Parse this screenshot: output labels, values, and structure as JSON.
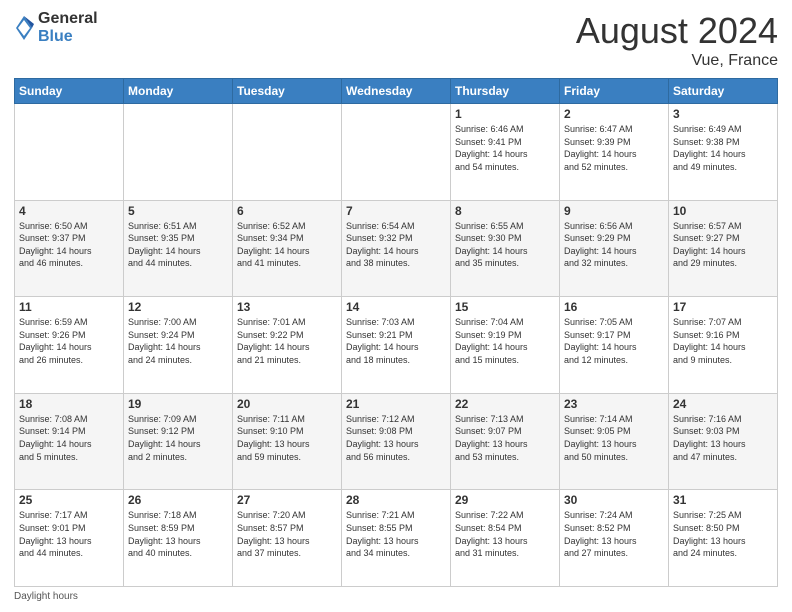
{
  "header": {
    "logo_line1": "General",
    "logo_line2": "Blue",
    "month_year": "August 2024",
    "location": "Vue, France"
  },
  "days_of_week": [
    "Sunday",
    "Monday",
    "Tuesday",
    "Wednesday",
    "Thursday",
    "Friday",
    "Saturday"
  ],
  "weeks": [
    [
      {
        "num": "",
        "info": ""
      },
      {
        "num": "",
        "info": ""
      },
      {
        "num": "",
        "info": ""
      },
      {
        "num": "",
        "info": ""
      },
      {
        "num": "1",
        "info": "Sunrise: 6:46 AM\nSunset: 9:41 PM\nDaylight: 14 hours\nand 54 minutes."
      },
      {
        "num": "2",
        "info": "Sunrise: 6:47 AM\nSunset: 9:39 PM\nDaylight: 14 hours\nand 52 minutes."
      },
      {
        "num": "3",
        "info": "Sunrise: 6:49 AM\nSunset: 9:38 PM\nDaylight: 14 hours\nand 49 minutes."
      }
    ],
    [
      {
        "num": "4",
        "info": "Sunrise: 6:50 AM\nSunset: 9:37 PM\nDaylight: 14 hours\nand 46 minutes."
      },
      {
        "num": "5",
        "info": "Sunrise: 6:51 AM\nSunset: 9:35 PM\nDaylight: 14 hours\nand 44 minutes."
      },
      {
        "num": "6",
        "info": "Sunrise: 6:52 AM\nSunset: 9:34 PM\nDaylight: 14 hours\nand 41 minutes."
      },
      {
        "num": "7",
        "info": "Sunrise: 6:54 AM\nSunset: 9:32 PM\nDaylight: 14 hours\nand 38 minutes."
      },
      {
        "num": "8",
        "info": "Sunrise: 6:55 AM\nSunset: 9:30 PM\nDaylight: 14 hours\nand 35 minutes."
      },
      {
        "num": "9",
        "info": "Sunrise: 6:56 AM\nSunset: 9:29 PM\nDaylight: 14 hours\nand 32 minutes."
      },
      {
        "num": "10",
        "info": "Sunrise: 6:57 AM\nSunset: 9:27 PM\nDaylight: 14 hours\nand 29 minutes."
      }
    ],
    [
      {
        "num": "11",
        "info": "Sunrise: 6:59 AM\nSunset: 9:26 PM\nDaylight: 14 hours\nand 26 minutes."
      },
      {
        "num": "12",
        "info": "Sunrise: 7:00 AM\nSunset: 9:24 PM\nDaylight: 14 hours\nand 24 minutes."
      },
      {
        "num": "13",
        "info": "Sunrise: 7:01 AM\nSunset: 9:22 PM\nDaylight: 14 hours\nand 21 minutes."
      },
      {
        "num": "14",
        "info": "Sunrise: 7:03 AM\nSunset: 9:21 PM\nDaylight: 14 hours\nand 18 minutes."
      },
      {
        "num": "15",
        "info": "Sunrise: 7:04 AM\nSunset: 9:19 PM\nDaylight: 14 hours\nand 15 minutes."
      },
      {
        "num": "16",
        "info": "Sunrise: 7:05 AM\nSunset: 9:17 PM\nDaylight: 14 hours\nand 12 minutes."
      },
      {
        "num": "17",
        "info": "Sunrise: 7:07 AM\nSunset: 9:16 PM\nDaylight: 14 hours\nand 9 minutes."
      }
    ],
    [
      {
        "num": "18",
        "info": "Sunrise: 7:08 AM\nSunset: 9:14 PM\nDaylight: 14 hours\nand 5 minutes."
      },
      {
        "num": "19",
        "info": "Sunrise: 7:09 AM\nSunset: 9:12 PM\nDaylight: 14 hours\nand 2 minutes."
      },
      {
        "num": "20",
        "info": "Sunrise: 7:11 AM\nSunset: 9:10 PM\nDaylight: 13 hours\nand 59 minutes."
      },
      {
        "num": "21",
        "info": "Sunrise: 7:12 AM\nSunset: 9:08 PM\nDaylight: 13 hours\nand 56 minutes."
      },
      {
        "num": "22",
        "info": "Sunrise: 7:13 AM\nSunset: 9:07 PM\nDaylight: 13 hours\nand 53 minutes."
      },
      {
        "num": "23",
        "info": "Sunrise: 7:14 AM\nSunset: 9:05 PM\nDaylight: 13 hours\nand 50 minutes."
      },
      {
        "num": "24",
        "info": "Sunrise: 7:16 AM\nSunset: 9:03 PM\nDaylight: 13 hours\nand 47 minutes."
      }
    ],
    [
      {
        "num": "25",
        "info": "Sunrise: 7:17 AM\nSunset: 9:01 PM\nDaylight: 13 hours\nand 44 minutes."
      },
      {
        "num": "26",
        "info": "Sunrise: 7:18 AM\nSunset: 8:59 PM\nDaylight: 13 hours\nand 40 minutes."
      },
      {
        "num": "27",
        "info": "Sunrise: 7:20 AM\nSunset: 8:57 PM\nDaylight: 13 hours\nand 37 minutes."
      },
      {
        "num": "28",
        "info": "Sunrise: 7:21 AM\nSunset: 8:55 PM\nDaylight: 13 hours\nand 34 minutes."
      },
      {
        "num": "29",
        "info": "Sunrise: 7:22 AM\nSunset: 8:54 PM\nDaylight: 13 hours\nand 31 minutes."
      },
      {
        "num": "30",
        "info": "Sunrise: 7:24 AM\nSunset: 8:52 PM\nDaylight: 13 hours\nand 27 minutes."
      },
      {
        "num": "31",
        "info": "Sunrise: 7:25 AM\nSunset: 8:50 PM\nDaylight: 13 hours\nand 24 minutes."
      }
    ]
  ],
  "footer": {
    "daylight_label": "Daylight hours"
  }
}
